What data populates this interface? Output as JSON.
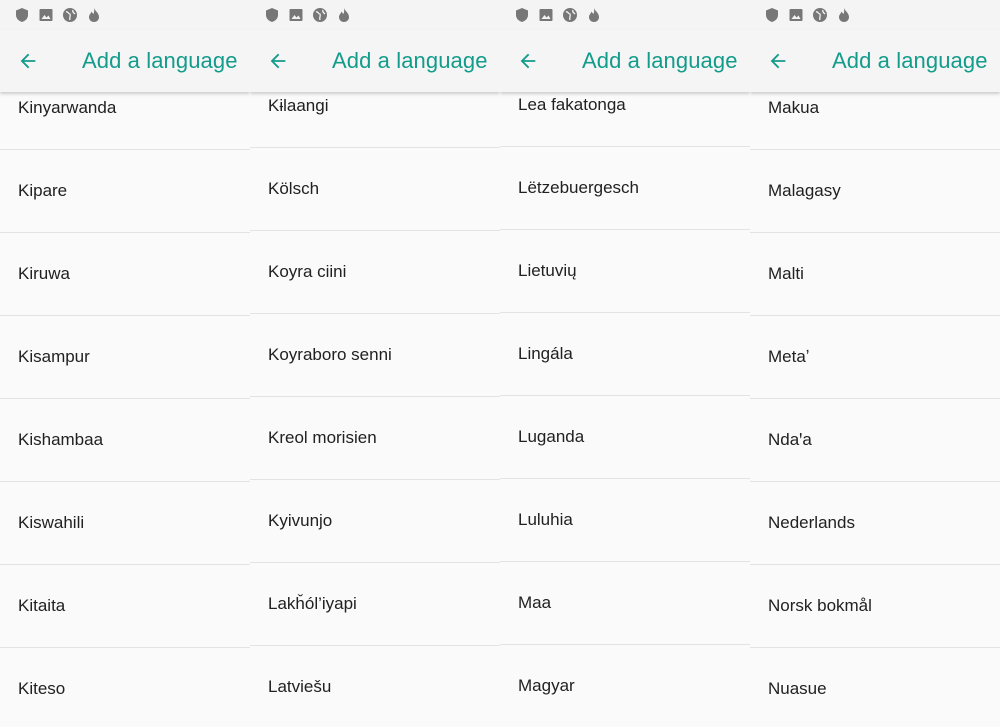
{
  "status_icons": [
    "shield-icon",
    "image-icon",
    "globe-icon",
    "flame-icon"
  ],
  "accent_color": "#139b8b",
  "panels": [
    {
      "title": "Add a language",
      "languages": [
        "Kinyarwanda",
        "Kipare",
        "Kiruwa",
        "Kisampur",
        "Kishambaa",
        "Kiswahili",
        "Kitaita",
        "Kiteso"
      ]
    },
    {
      "title": "Add a language",
      "languages": [
        "Kɨlaangi",
        "Kölsch",
        "Koyra ciini",
        "Koyraboro senni",
        "Kreol morisien",
        "Kyivunjo",
        "Lakȟól’iyapi",
        "Latviešu"
      ]
    },
    {
      "title": "Add a language",
      "languages": [
        "Lea fakatonga",
        "Lëtzebuergesch",
        "Lietuvių",
        "Lingála",
        "Luganda",
        "Luluhia",
        "Maa",
        "Magyar"
      ]
    },
    {
      "title": "Add a language",
      "languages": [
        "Makua",
        "Malagasy",
        "Malti",
        "Metaʼ",
        "Ndaꞌa",
        "Nederlands",
        "Norsk bokmål",
        "Nuasue"
      ]
    }
  ]
}
